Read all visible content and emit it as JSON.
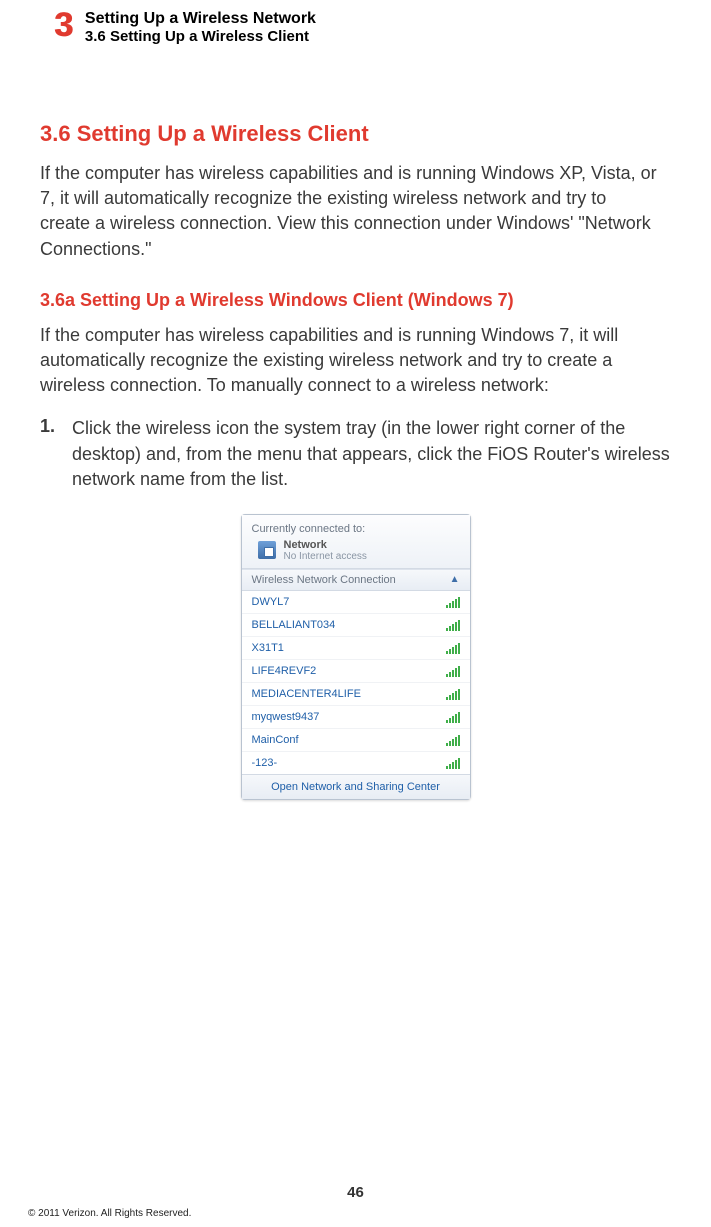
{
  "header": {
    "chapter_number": "3",
    "title": "Setting Up a Wireless Network",
    "subtitle": "3.6  Setting Up a Wireless Client"
  },
  "section": {
    "heading": "3.6  Setting Up a Wireless Client",
    "intro": "If the computer has wireless capabilities and is running Windows XP, Vista, or 7, it will automatically recognize the existing wireless network and try to create a wireless connection. View this connection under Windows' \"Network Connections.\""
  },
  "subsection": {
    "heading": "3.6a  Setting Up a Wireless Windows Client (Windows 7)",
    "intro": "If the computer has wireless capabilities and is running Windows 7, it will automatically recognize the existing wireless network and try to create a wireless connection. To manually connect to a wireless network:",
    "steps": [
      {
        "num": "1.",
        "text": "Click the wireless icon the system tray (in the lower right corner of the desktop) and, from the menu that appears, click the FiOS Router's wireless network name from the list."
      }
    ]
  },
  "wifi_popup": {
    "connected_label": "Currently connected to:",
    "network_name": "Network",
    "network_status": "No Internet access",
    "section_label": "Wireless Network Connection",
    "items": [
      "DWYL7",
      "BELLALIANT034",
      "X31T1",
      "LIFE4REVF2",
      "MEDIACENTER4LIFE",
      "myqwest9437",
      "MainConf",
      "-123-"
    ],
    "footer": "Open Network and Sharing Center"
  },
  "page_number": "46",
  "copyright": "© 2011 Verizon. All Rights Reserved."
}
